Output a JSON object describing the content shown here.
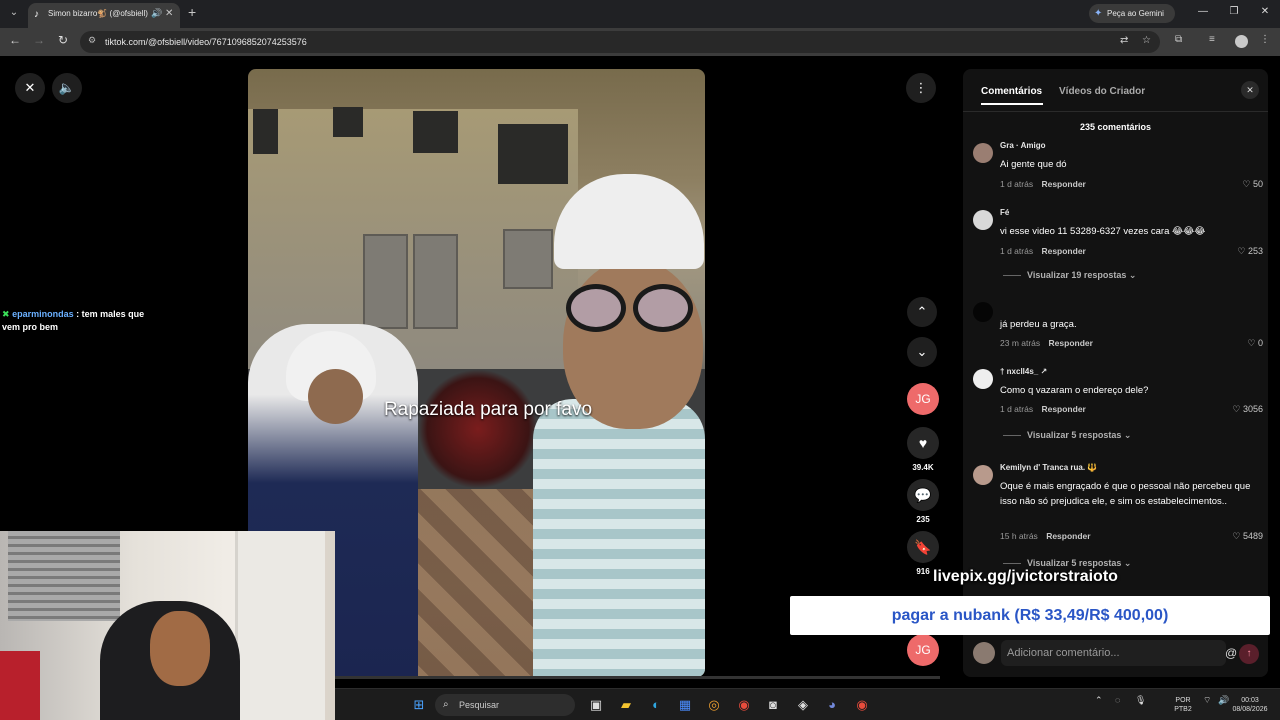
{
  "browser": {
    "tab_title": "Simon bizarro🐒 (@ofsbiell)",
    "url": "tiktok.com/@ofsbiell/video/7671096852074253576",
    "gemini_label": "Peça ao Gemini"
  },
  "video": {
    "caption": "Rapaziada para por favo",
    "like_count": "39.4K",
    "comment_count": "235",
    "bookmark_count": "916",
    "avatar_initials": "JG",
    "progress_fraction": 0.0
  },
  "chat": {
    "user": "eparminondas",
    "message": ": tem males que vem pro bem"
  },
  "comments_panel": {
    "tab_comments": "Comentários",
    "tab_creator": "Vídeos do Criador",
    "count_label": "235 comentários",
    "reply_label": "Responder",
    "comments": [
      {
        "user": "Gra · Amigo",
        "text": "Ai gente que dó",
        "time": "1 d atrás",
        "likes": "50"
      },
      {
        "user": "Fé",
        "text": "vi esse video 11 53289-6327 vezes cara 😂😂😂",
        "time": "1 d atrás",
        "likes": "253",
        "replies": "Visualizar 19 respostas"
      },
      {
        "user": "",
        "text": "já perdeu a graça.",
        "time": "23 m atrás",
        "likes": "0"
      },
      {
        "user": "† nxcll4s_ ↗",
        "text": "Como q vazaram o endereço dele?",
        "time": "1 d atrás",
        "likes": "3056",
        "replies": "Visualizar 5 respostas"
      },
      {
        "user": "Kemilyn d' Tranca rua. 🔱",
        "text": "Oque é mais engraçado é que o pessoal não percebeu que isso não só prejudica ele, e sim os estabelecimentos..",
        "time": "15 h atrás",
        "likes": "5489",
        "replies": "Visualizar 5 respostas"
      }
    ],
    "input_placeholder": "Adicionar comentário..."
  },
  "overlay": {
    "livepix": "livepix.gg/jvictorstraioto",
    "donation": "pagar a nubank (R$ 33,49/R$ 400,00)"
  },
  "taskbar": {
    "search_placeholder": "Pesquisar",
    "lang_top": "POR",
    "lang_bottom": "PTB2",
    "time": "00:03",
    "date": "08/08/2026"
  }
}
